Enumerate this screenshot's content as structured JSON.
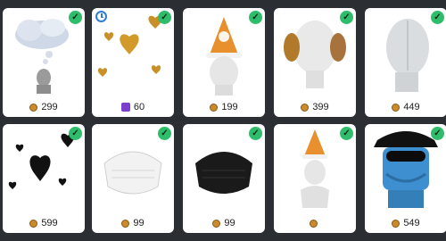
{
  "items": [
    {
      "price": "299",
      "currency": "coin-icon"
    },
    {
      "price": "60",
      "currency": "gem-icon"
    },
    {
      "price": "199",
      "currency": "coin-icon"
    },
    {
      "price": "399",
      "currency": "coin-icon"
    },
    {
      "price": "449",
      "currency": "coin-icon"
    },
    {
      "price": "599",
      "currency": "coin-icon"
    },
    {
      "price": "99",
      "currency": "coin-icon"
    },
    {
      "price": "99",
      "currency": "coin-icon"
    },
    {
      "price": "",
      "currency": "coin-icon"
    },
    {
      "price": "549",
      "currency": "coin-icon"
    }
  ],
  "colors": {
    "owned_check": "#2ebd6a",
    "limited_clock": "#2a7fd6",
    "coin": "#c98b2b",
    "gem": "#7b3fc9"
  }
}
